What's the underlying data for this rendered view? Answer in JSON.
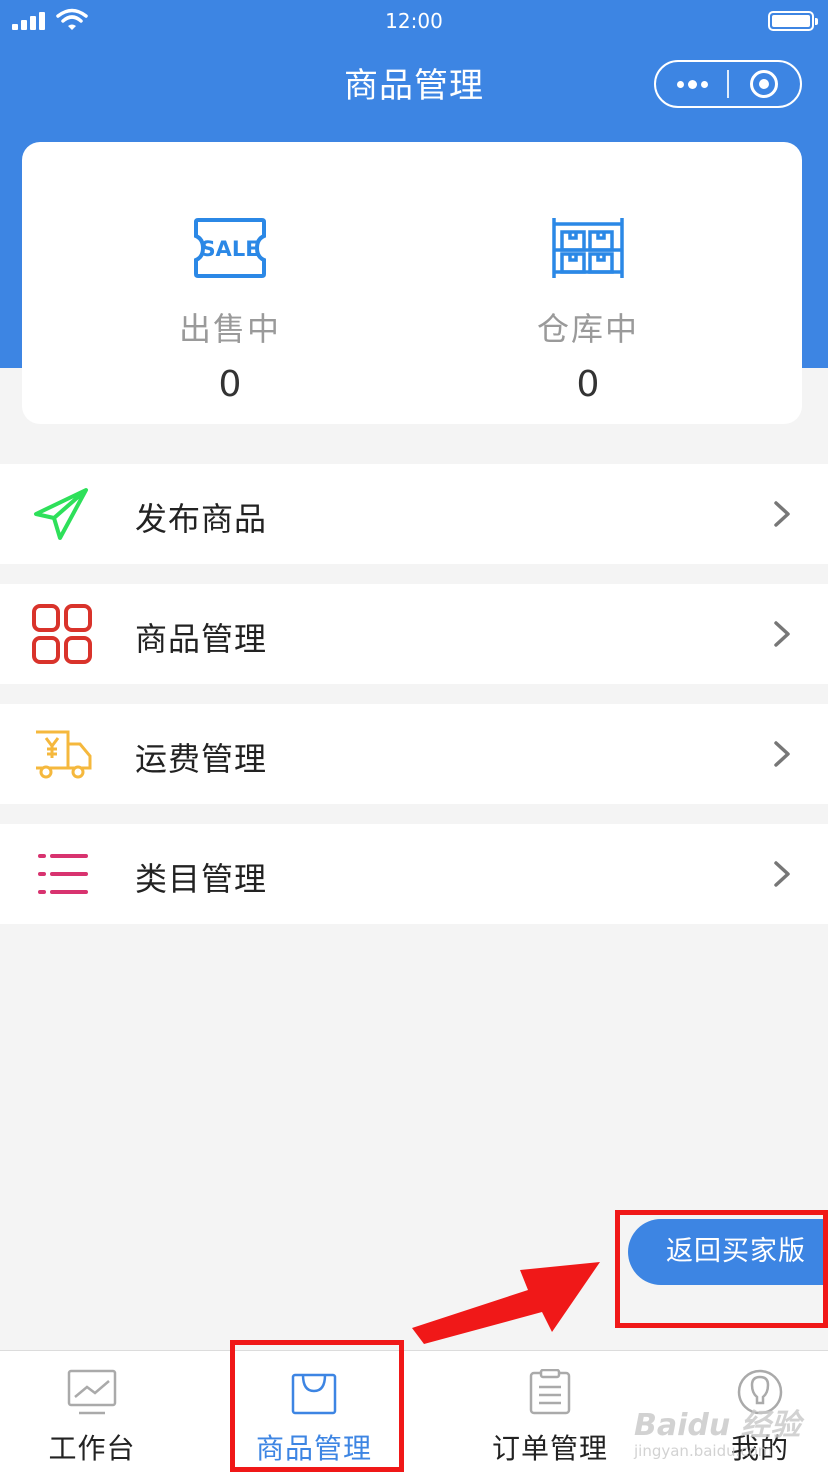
{
  "status_bar": {
    "time": "12:00"
  },
  "nav": {
    "title": "商品管理"
  },
  "stats": [
    {
      "label": "出售中",
      "value": "0",
      "icon": "sale-tag-icon",
      "icon_text": "SALE"
    },
    {
      "label": "仓库中",
      "value": "0",
      "icon": "warehouse-shelf-icon"
    }
  ],
  "menu": [
    {
      "label": "发布商品",
      "icon": "paper-plane-icon",
      "color": "#2ee05a"
    },
    {
      "label": "商品管理",
      "icon": "grid-squares-icon",
      "color": "#d9332b"
    },
    {
      "label": "运费管理",
      "icon": "delivery-truck-icon",
      "color": "#f5b83d"
    },
    {
      "label": "类目管理",
      "icon": "list-icon",
      "color": "#d8336f"
    }
  ],
  "back_button": {
    "label": "返回买家版"
  },
  "tabs": [
    {
      "label": "工作台",
      "icon": "dashboard-chart-icon",
      "active": false
    },
    {
      "label": "商品管理",
      "icon": "shopping-bag-icon",
      "active": true
    },
    {
      "label": "订单管理",
      "icon": "order-clipboard-icon",
      "active": false
    },
    {
      "label": "我的",
      "icon": "user-profile-icon",
      "active": false
    }
  ],
  "watermark": {
    "brand": "Baidu 经验",
    "url": "jingyan.baidu.com"
  },
  "colors": {
    "primary": "#3d85e3",
    "highlight": "#f01818",
    "background": "#f4f4f4"
  }
}
